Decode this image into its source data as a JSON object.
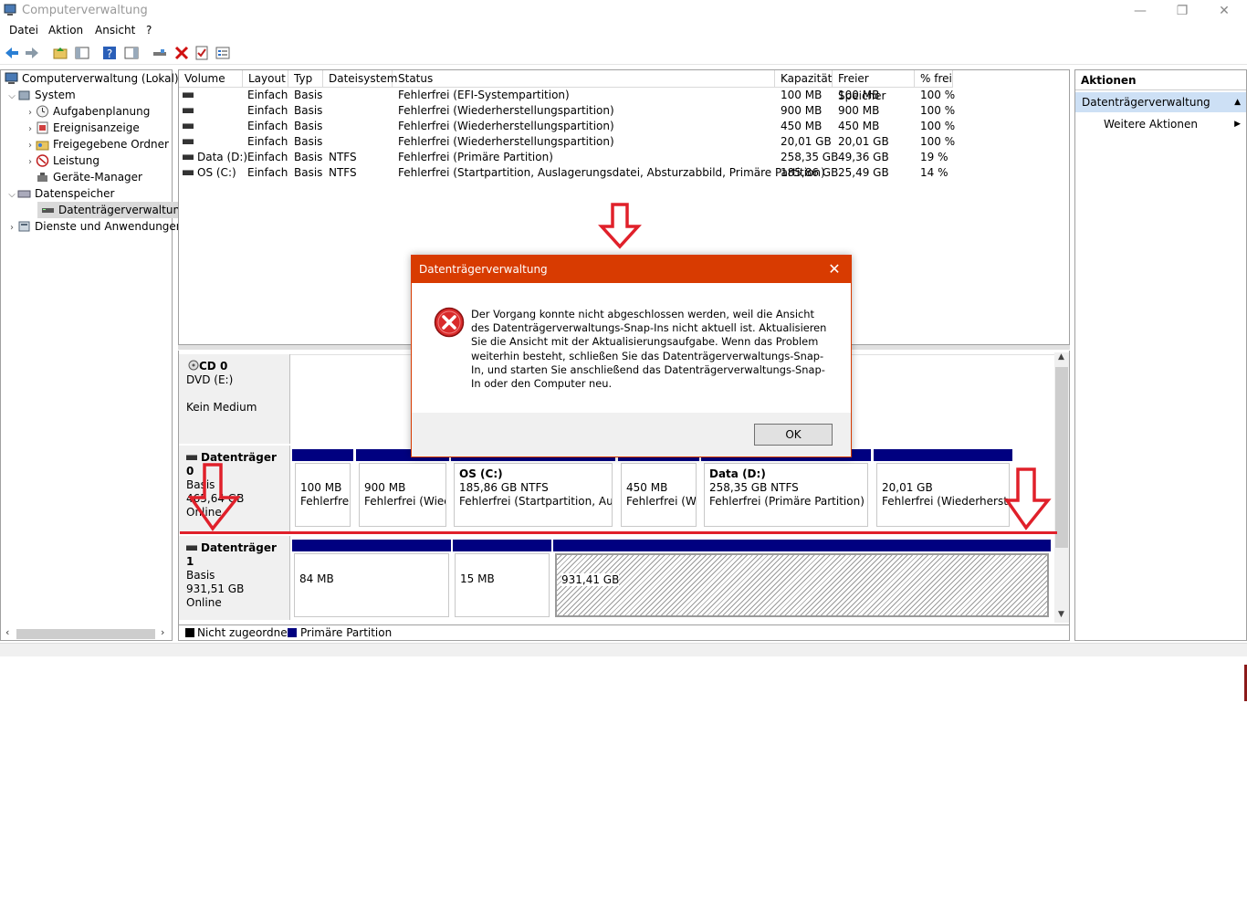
{
  "window": {
    "title": "Computerverwaltung",
    "minimize": "—",
    "restore": "❐",
    "close": "✕"
  },
  "menu": [
    "Datei",
    "Aktion",
    "Ansicht",
    "?"
  ],
  "tree": {
    "root": "Computerverwaltung (Lokal)",
    "system": "System",
    "aufgaben": "Aufgabenplanung",
    "ereignis": "Ereignisanzeige",
    "ordner": "Freigegebene Ordner",
    "leistung": "Leistung",
    "geraete": "Geräte-Manager",
    "datenspeicher": "Datenspeicher",
    "dtv": "Datenträgerverwaltung",
    "dienste": "Dienste und Anwendungen"
  },
  "columns": {
    "volume": "Volume",
    "layout": "Layout",
    "typ": "Typ",
    "dateisystem": "Dateisystem",
    "status": "Status",
    "kapazitaet": "Kapazität",
    "frei": "Freier Speicher",
    "prozent": "% frei"
  },
  "volumes": [
    {
      "name": "",
      "layout": "Einfach",
      "typ": "Basis",
      "fs": "",
      "status": "Fehlerfrei (EFI-Systempartition)",
      "cap": "100 MB",
      "free": "100 MB",
      "pct": "100 %"
    },
    {
      "name": "",
      "layout": "Einfach",
      "typ": "Basis",
      "fs": "",
      "status": "Fehlerfrei (Wiederherstellungspartition)",
      "cap": "900 MB",
      "free": "900 MB",
      "pct": "100 %"
    },
    {
      "name": "",
      "layout": "Einfach",
      "typ": "Basis",
      "fs": "",
      "status": "Fehlerfrei (Wiederherstellungspartition)",
      "cap": "450 MB",
      "free": "450 MB",
      "pct": "100 %"
    },
    {
      "name": "",
      "layout": "Einfach",
      "typ": "Basis",
      "fs": "",
      "status": "Fehlerfrei (Wiederherstellungspartition)",
      "cap": "20,01 GB",
      "free": "20,01 GB",
      "pct": "100 %"
    },
    {
      "name": "Data (D:)",
      "layout": "Einfach",
      "typ": "Basis",
      "fs": "NTFS",
      "status": "Fehlerfrei (Primäre Partition)",
      "cap": "258,35 GB",
      "free": "49,36 GB",
      "pct": "19 %"
    },
    {
      "name": "OS (C:)",
      "layout": "Einfach",
      "typ": "Basis",
      "fs": "NTFS",
      "status": "Fehlerfrei (Startpartition, Auslagerungsdatei, Absturzabbild, Primäre Partition)",
      "cap": "185,86 GB",
      "free": "25,49 GB",
      "pct": "14 %"
    }
  ],
  "cd0": {
    "name": "CD 0",
    "type": "DVD (E:)",
    "state": "Kein Medium"
  },
  "disk0": {
    "name": "Datenträger 0",
    "type": "Basis",
    "size": "465,64 GB",
    "state": "Online",
    "partitions": [
      {
        "title": "",
        "size": "100 MB",
        "status": "Fehlerfrei (EFI-Systempartition)"
      },
      {
        "title": "",
        "size": "900 MB",
        "status": "Fehlerfrei (Wiederherstellungspartition)"
      },
      {
        "title": "OS  (C:)",
        "size": "185,86 GB NTFS",
        "status": "Fehlerfrei (Startpartition, Auslagerungsdatei, Absturzabbild, Primäre Partition)"
      },
      {
        "title": "",
        "size": "450 MB",
        "status": "Fehlerfrei (Wiederherstellungspartition)"
      },
      {
        "title": "Data  (D:)",
        "size": "258,35 GB NTFS",
        "status": "Fehlerfrei (Primäre Partition)"
      },
      {
        "title": "",
        "size": "20,01 GB",
        "status": "Fehlerfrei (Wiederherstellungspartition)"
      }
    ]
  },
  "disk1": {
    "name": "Datenträger 1",
    "type": "Basis",
    "size": "931,51 GB",
    "state": "Online",
    "partitions": [
      {
        "size": "84 MB"
      },
      {
        "size": "15 MB"
      },
      {
        "size": "931,41 GB"
      }
    ]
  },
  "legend": {
    "unallocated": "Nicht zugeordnet",
    "primary": "Primäre Partition"
  },
  "actions": {
    "header": "Aktionen",
    "section": "Datenträgerverwaltung",
    "more": "Weitere Aktionen"
  },
  "dialog": {
    "title": "Datenträgerverwaltung",
    "message": "Der Vorgang konnte nicht abgeschlossen werden, weil die Ansicht des Datenträgerverwaltungs-Snap-Ins nicht aktuell ist. Aktualisieren Sie die Ansicht mit der Aktualisierungsaufgabe. Wenn das Problem weiterhin besteht, schließen Sie das Datenträgerverwaltungs-Snap-In, und starten Sie anschließend das Datenträgerverwaltungs-Snap-In oder den Computer neu.",
    "ok": "OK"
  },
  "colors": {
    "accent": "#d83b01",
    "primary_partition": "#000080",
    "annotation": "#e0202a"
  }
}
